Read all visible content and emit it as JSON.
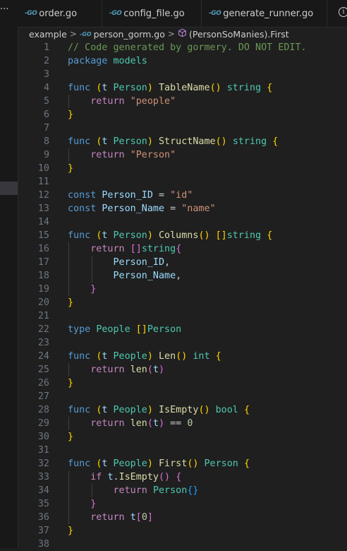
{
  "activity": {
    "more_glyph": "···"
  },
  "tabs": [
    {
      "go_badge": "-GO",
      "label": "order.go"
    },
    {
      "go_badge": "-GO",
      "label": "config_file.go"
    },
    {
      "go_badge": "-GO",
      "label": "generate_runner.go"
    }
  ],
  "tab_info_glyph": "i",
  "breadcrumb": {
    "folder": "example",
    "sep1": ">",
    "file_badge": "-GO",
    "file": "person_gorm.go",
    "sep2": ">",
    "symbol": "(PersonSoManies).First"
  },
  "colors": {
    "keyword": "#569cd6",
    "control": "#c586c0",
    "type": "#4ec9b0",
    "function": "#dcdcaa",
    "variable": "#9cdcfe",
    "string": "#ce9178",
    "number": "#b5cea8",
    "comment": "#6a9955",
    "bracket1": "#ffd700",
    "bracket2": "#da70d6",
    "bracket3": "#179fff"
  },
  "lines": [
    {
      "n": "1",
      "indent": 0,
      "tokens": [
        [
          "// Code generated by gormery. DO NOT EDIT.",
          "cm"
        ]
      ]
    },
    {
      "n": "2",
      "indent": 0,
      "tokens": [
        [
          "package",
          "kw"
        ],
        [
          " models",
          "ty"
        ]
      ]
    },
    {
      "n": "3",
      "indent": 0,
      "tokens": []
    },
    {
      "n": "4",
      "indent": 0,
      "tokens": [
        [
          "func",
          "kw"
        ],
        [
          " ",
          "pl"
        ],
        [
          "(",
          "b1"
        ],
        [
          "t",
          "vr"
        ],
        [
          " ",
          "pl"
        ],
        [
          "Person",
          "ty"
        ],
        [
          ")",
          "b1"
        ],
        [
          " ",
          "pl"
        ],
        [
          "TableName",
          "fn"
        ],
        [
          "()",
          "b1"
        ],
        [
          " ",
          "pl"
        ],
        [
          "string",
          "ty"
        ],
        [
          " ",
          "pl"
        ],
        [
          "{",
          "b1"
        ]
      ]
    },
    {
      "n": "5",
      "indent": 1,
      "tokens": [
        [
          "    ",
          "pl"
        ],
        [
          "return",
          "kw2"
        ],
        [
          " ",
          "pl"
        ],
        [
          "\"people\"",
          "str"
        ]
      ]
    },
    {
      "n": "6",
      "indent": 0,
      "tokens": [
        [
          "}",
          "b1"
        ]
      ]
    },
    {
      "n": "7",
      "indent": 0,
      "tokens": []
    },
    {
      "n": "8",
      "indent": 0,
      "tokens": [
        [
          "func",
          "kw"
        ],
        [
          " ",
          "pl"
        ],
        [
          "(",
          "b1"
        ],
        [
          "t",
          "vr"
        ],
        [
          " ",
          "pl"
        ],
        [
          "Person",
          "ty"
        ],
        [
          ")",
          "b1"
        ],
        [
          " ",
          "pl"
        ],
        [
          "StructName",
          "fn"
        ],
        [
          "()",
          "b1"
        ],
        [
          " ",
          "pl"
        ],
        [
          "string",
          "ty"
        ],
        [
          " ",
          "pl"
        ],
        [
          "{",
          "b1"
        ]
      ]
    },
    {
      "n": "9",
      "indent": 1,
      "tokens": [
        [
          "    ",
          "pl"
        ],
        [
          "return",
          "kw2"
        ],
        [
          " ",
          "pl"
        ],
        [
          "\"Person\"",
          "str"
        ]
      ]
    },
    {
      "n": "10",
      "indent": 0,
      "tokens": [
        [
          "}",
          "b1"
        ]
      ]
    },
    {
      "n": "11",
      "indent": 0,
      "tokens": []
    },
    {
      "n": "12",
      "indent": 0,
      "tokens": [
        [
          "const",
          "kw"
        ],
        [
          " ",
          "pl"
        ],
        [
          "Person_ID",
          "vr"
        ],
        [
          " = ",
          "pl"
        ],
        [
          "\"id\"",
          "str"
        ]
      ]
    },
    {
      "n": "13",
      "indent": 0,
      "tokens": [
        [
          "const",
          "kw"
        ],
        [
          " ",
          "pl"
        ],
        [
          "Person_Name",
          "vr"
        ],
        [
          " = ",
          "pl"
        ],
        [
          "\"name\"",
          "str"
        ]
      ]
    },
    {
      "n": "14",
      "indent": 0,
      "tokens": []
    },
    {
      "n": "15",
      "indent": 0,
      "tokens": [
        [
          "func",
          "kw"
        ],
        [
          " ",
          "pl"
        ],
        [
          "(",
          "b1"
        ],
        [
          "t",
          "vr"
        ],
        [
          " ",
          "pl"
        ],
        [
          "Person",
          "ty"
        ],
        [
          ")",
          "b1"
        ],
        [
          " ",
          "pl"
        ],
        [
          "Columns",
          "fn"
        ],
        [
          "()",
          "b1"
        ],
        [
          " ",
          "pl"
        ],
        [
          "[]",
          "b1"
        ],
        [
          "string",
          "ty"
        ],
        [
          " ",
          "pl"
        ],
        [
          "{",
          "b1"
        ]
      ]
    },
    {
      "n": "16",
      "indent": 1,
      "tokens": [
        [
          "    ",
          "pl"
        ],
        [
          "return",
          "kw2"
        ],
        [
          " ",
          "pl"
        ],
        [
          "[]",
          "b2"
        ],
        [
          "string",
          "ty"
        ],
        [
          "{",
          "b2"
        ]
      ]
    },
    {
      "n": "17",
      "indent": 2,
      "tokens": [
        [
          "        ",
          "pl"
        ],
        [
          "Person_ID",
          "vr"
        ],
        [
          ",",
          "pl"
        ]
      ]
    },
    {
      "n": "18",
      "indent": 2,
      "tokens": [
        [
          "        ",
          "pl"
        ],
        [
          "Person_Name",
          "vr"
        ],
        [
          ",",
          "pl"
        ]
      ]
    },
    {
      "n": "19",
      "indent": 1,
      "tokens": [
        [
          "    ",
          "pl"
        ],
        [
          "}",
          "b2"
        ]
      ]
    },
    {
      "n": "20",
      "indent": 0,
      "tokens": [
        [
          "}",
          "b1"
        ]
      ]
    },
    {
      "n": "21",
      "indent": 0,
      "tokens": []
    },
    {
      "n": "22",
      "indent": 0,
      "tokens": [
        [
          "type",
          "kw"
        ],
        [
          " ",
          "pl"
        ],
        [
          "People",
          "ty"
        ],
        [
          " ",
          "pl"
        ],
        [
          "[]",
          "b1"
        ],
        [
          "Person",
          "ty"
        ]
      ]
    },
    {
      "n": "23",
      "indent": 0,
      "tokens": []
    },
    {
      "n": "24",
      "indent": 0,
      "tokens": [
        [
          "func",
          "kw"
        ],
        [
          " ",
          "pl"
        ],
        [
          "(",
          "b1"
        ],
        [
          "t",
          "vr"
        ],
        [
          " ",
          "pl"
        ],
        [
          "People",
          "ty"
        ],
        [
          ")",
          "b1"
        ],
        [
          " ",
          "pl"
        ],
        [
          "Len",
          "fn"
        ],
        [
          "()",
          "b1"
        ],
        [
          " ",
          "pl"
        ],
        [
          "int",
          "ty"
        ],
        [
          " ",
          "pl"
        ],
        [
          "{",
          "b1"
        ]
      ]
    },
    {
      "n": "25",
      "indent": 1,
      "tokens": [
        [
          "    ",
          "pl"
        ],
        [
          "return",
          "kw2"
        ],
        [
          " ",
          "pl"
        ],
        [
          "len",
          "fn"
        ],
        [
          "(",
          "b2"
        ],
        [
          "t",
          "vr"
        ],
        [
          ")",
          "b2"
        ]
      ]
    },
    {
      "n": "26",
      "indent": 0,
      "tokens": [
        [
          "}",
          "b1"
        ]
      ]
    },
    {
      "n": "27",
      "indent": 0,
      "tokens": []
    },
    {
      "n": "28",
      "indent": 0,
      "tokens": [
        [
          "func",
          "kw"
        ],
        [
          " ",
          "pl"
        ],
        [
          "(",
          "b1"
        ],
        [
          "t",
          "vr"
        ],
        [
          " ",
          "pl"
        ],
        [
          "People",
          "ty"
        ],
        [
          ")",
          "b1"
        ],
        [
          " ",
          "pl"
        ],
        [
          "IsEmpty",
          "fn"
        ],
        [
          "()",
          "b1"
        ],
        [
          " ",
          "pl"
        ],
        [
          "bool",
          "ty"
        ],
        [
          " ",
          "pl"
        ],
        [
          "{",
          "b1"
        ]
      ]
    },
    {
      "n": "29",
      "indent": 1,
      "tokens": [
        [
          "    ",
          "pl"
        ],
        [
          "return",
          "kw2"
        ],
        [
          " ",
          "pl"
        ],
        [
          "len",
          "fn"
        ],
        [
          "(",
          "b2"
        ],
        [
          "t",
          "vr"
        ],
        [
          ")",
          "b2"
        ],
        [
          " == ",
          "pl"
        ],
        [
          "0",
          "num"
        ]
      ]
    },
    {
      "n": "30",
      "indent": 0,
      "tokens": [
        [
          "}",
          "b1"
        ]
      ]
    },
    {
      "n": "31",
      "indent": 0,
      "tokens": []
    },
    {
      "n": "32",
      "indent": 0,
      "tokens": [
        [
          "func",
          "kw"
        ],
        [
          " ",
          "pl"
        ],
        [
          "(",
          "b1"
        ],
        [
          "t",
          "vr"
        ],
        [
          " ",
          "pl"
        ],
        [
          "People",
          "ty"
        ],
        [
          ")",
          "b1"
        ],
        [
          " ",
          "pl"
        ],
        [
          "First",
          "fn"
        ],
        [
          "()",
          "b1"
        ],
        [
          " ",
          "pl"
        ],
        [
          "Person",
          "ty"
        ],
        [
          " ",
          "pl"
        ],
        [
          "{",
          "b1"
        ]
      ]
    },
    {
      "n": "33",
      "indent": 1,
      "tokens": [
        [
          "    ",
          "pl"
        ],
        [
          "if",
          "kw2"
        ],
        [
          " ",
          "pl"
        ],
        [
          "t",
          "vr"
        ],
        [
          ".",
          "pl"
        ],
        [
          "IsEmpty",
          "fn"
        ],
        [
          "()",
          "b2"
        ],
        [
          " ",
          "pl"
        ],
        [
          "{",
          "b2"
        ]
      ]
    },
    {
      "n": "34",
      "indent": 2,
      "tokens": [
        [
          "        ",
          "pl"
        ],
        [
          "return",
          "kw2"
        ],
        [
          " ",
          "pl"
        ],
        [
          "Person",
          "ty"
        ],
        [
          "{}",
          "b3"
        ]
      ]
    },
    {
      "n": "35",
      "indent": 1,
      "tokens": [
        [
          "    ",
          "pl"
        ],
        [
          "}",
          "b2"
        ]
      ]
    },
    {
      "n": "36",
      "indent": 1,
      "tokens": [
        [
          "    ",
          "pl"
        ],
        [
          "return",
          "kw2"
        ],
        [
          " ",
          "pl"
        ],
        [
          "t",
          "vr"
        ],
        [
          "[",
          "b2"
        ],
        [
          "0",
          "num"
        ],
        [
          "]",
          "b2"
        ]
      ]
    },
    {
      "n": "37",
      "indent": 0,
      "tokens": [
        [
          "}",
          "b1"
        ]
      ]
    },
    {
      "n": "38",
      "indent": 0,
      "tokens": []
    }
  ]
}
